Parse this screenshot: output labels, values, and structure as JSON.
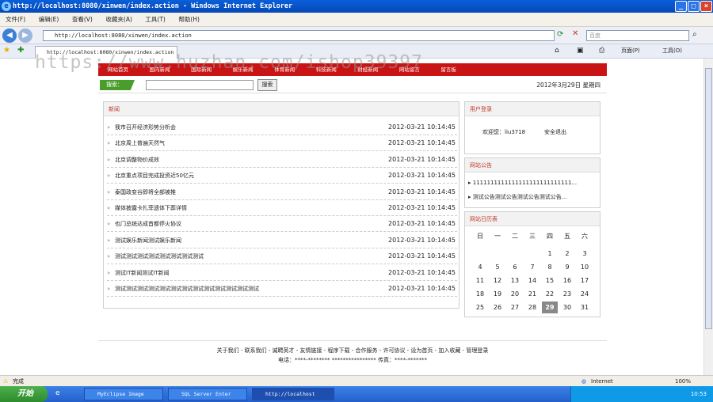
{
  "window": {
    "title": "http://localhost:8080/xinwen/index.action - Windows Internet Explorer"
  },
  "menu": [
    "文件(F)",
    "编辑(E)",
    "查看(V)",
    "收藏夹(A)",
    "工具(T)",
    "帮助(H)"
  ],
  "address": {
    "url": "http://localhost:8080/xinwen/index.action",
    "search_placeholder": "百度"
  },
  "tab": {
    "label": "http://localhost:8080/xinwen/index.action"
  },
  "toolbar": {
    "page_label": "页面(P)",
    "tools_label": "工具(O)"
  },
  "watermark": "https://www.huzhan.com/ishop39397",
  "nav": [
    "网站首页",
    "国内新闻",
    "国际新闻",
    "娱乐新闻",
    "体育新闻",
    "科技新闻",
    "财经新闻",
    "网站留言",
    "留言板"
  ],
  "search": {
    "label": "搜索：",
    "button": "搜索",
    "date": "2012年3月29日 星期四"
  },
  "news": {
    "title": "新闻",
    "items": [
      {
        "title": "我市召开经济形势分析会",
        "date": "2012-03-21 10:14:45"
      },
      {
        "title": "北京周上普遍天然气",
        "date": "2012-03-21 10:14:45"
      },
      {
        "title": "北京调整物价成效",
        "date": "2012-03-21 10:14:45"
      },
      {
        "title": "北京重点项目完成投资近50亿元",
        "date": "2012-03-21 10:14:45"
      },
      {
        "title": "泰国政变谷即将全部被推",
        "date": "2012-03-21 10:14:45"
      },
      {
        "title": "媒体披露卡扎菲遗体下葬详情",
        "date": "2012-03-21 10:14:45"
      },
      {
        "title": "也门总统达成首都停火协议",
        "date": "2012-03-21 10:14:45"
      },
      {
        "title": "测试娱乐新闻测试娱乐新闻",
        "date": "2012-03-21 10:14:45"
      },
      {
        "title": "测试测试测试测试测试测试测试测试",
        "date": "2012-03-21 10:14:45"
      },
      {
        "title": "测试IT新闻测试IT新闻",
        "date": "2012-03-21 10:14:45"
      },
      {
        "title": "测试测试测试测试测试测试测试测试测试测试测试测试测试",
        "date": "2012-03-21 10:14:45"
      }
    ]
  },
  "user": {
    "title": "用户登录",
    "welcome": "欢迎您：liu3718",
    "logout": "安全退出"
  },
  "notice": {
    "title": "网站公告",
    "items": [
      "1111111111111111111111111111...",
      "测试公告测试公告测试公告测试公告..."
    ]
  },
  "calendar": {
    "title": "网站日历表",
    "weekdays": [
      "日",
      "一",
      "二",
      "三",
      "四",
      "五",
      "六"
    ],
    "weeks": [
      [
        "",
        "",
        "",
        "",
        "1",
        "2",
        "3"
      ],
      [
        "4",
        "5",
        "6",
        "7",
        "8",
        "9",
        "10"
      ],
      [
        "11",
        "12",
        "13",
        "14",
        "15",
        "16",
        "17"
      ],
      [
        "18",
        "19",
        "20",
        "21",
        "22",
        "23",
        "24"
      ],
      [
        "25",
        "26",
        "27",
        "28",
        "29",
        "30",
        "31"
      ]
    ],
    "today": "29"
  },
  "footer": {
    "links": "关于我们 - 联系我们 - 诚聘英才 - 友情链接 - 程序下载 - 合作服务 - 许可协议 - 设为首页 - 加入收藏 - 管理登录",
    "contact": "电话：****-******** **************** 传真：****-*******"
  },
  "status": {
    "left": "完成",
    "zone": "Internet",
    "zoom": "100%"
  },
  "taskbar": {
    "start": "开始",
    "tasks": [
      "MyEclipse Image",
      "SQL Server Enter",
      "http://localhost"
    ],
    "time": "10:53"
  }
}
